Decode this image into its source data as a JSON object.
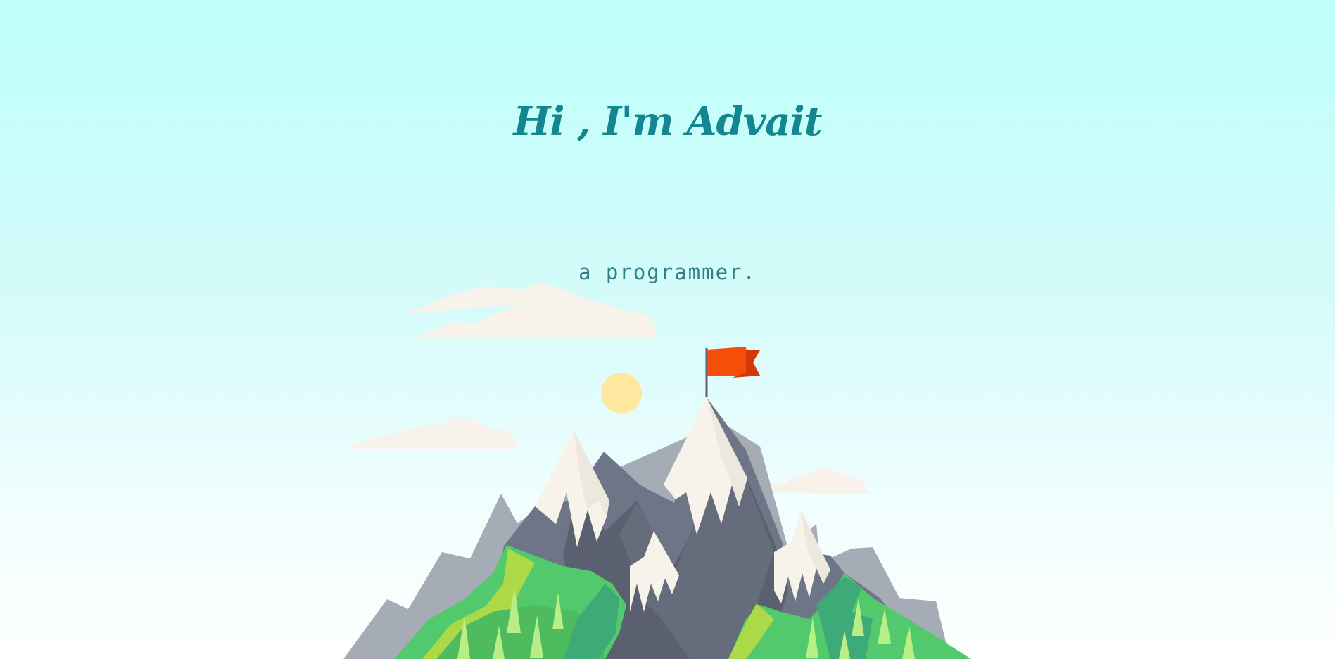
{
  "hero": {
    "title": "Hi , I'm Advait",
    "subtitle": "a programmer."
  },
  "illustration": {
    "icon": "mountain-summit-flag-illustration",
    "colors": {
      "sky_top": "#bdfffb",
      "title": "#13868f",
      "flag": "#f44e0a",
      "sun": "#ffe7a0",
      "snow": "#f7f3ea",
      "rock_dark": "#5a6070",
      "rock_mid": "#6d7586",
      "rock_light": "#a4aab4",
      "grass": "#52c96d",
      "grass_light": "#acd948"
    }
  }
}
